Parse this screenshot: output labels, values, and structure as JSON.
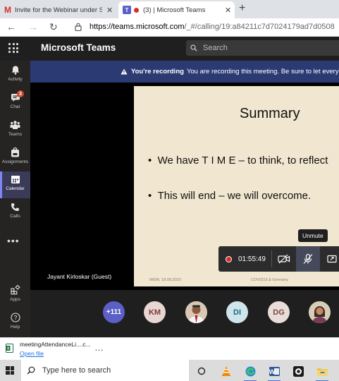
{
  "browser": {
    "tabs": [
      {
        "title": "Invite for the Webinar under Ser",
        "icon": "gmail-icon"
      },
      {
        "title": "(3) | Microsoft Teams",
        "icon": "teams-icon",
        "active": true
      }
    ],
    "address": {
      "host": "https://teams.microsoft.com",
      "path": "/_#/calling/19:a84211c7d7024179ad7d0508"
    }
  },
  "header": {
    "app_name": "Microsoft Teams",
    "search_placeholder": "Search"
  },
  "rail": {
    "items": [
      {
        "label": "Activity",
        "icon": "bell-icon"
      },
      {
        "label": "Chat",
        "icon": "chat-icon",
        "badge": "3"
      },
      {
        "label": "Teams",
        "icon": "teams-icon"
      },
      {
        "label": "Assignments",
        "icon": "backpack-icon"
      },
      {
        "label": "Calendar",
        "icon": "calendar-icon",
        "active": true
      },
      {
        "label": "Calls",
        "icon": "phone-icon"
      }
    ],
    "more": "•••",
    "bottom": [
      {
        "label": "Apps",
        "icon": "apps-icon"
      },
      {
        "label": "Help",
        "icon": "help-icon"
      }
    ]
  },
  "banner": {
    "strong": "You're recording",
    "text": "You are recording this meeting. Be sure to let every"
  },
  "stage": {
    "guest_name": "Jayant Kirloskar (Guest)",
    "slide": {
      "title": "Summary",
      "bullets": [
        "We have T I M E – to think, to reflect",
        "This will end – we will overcome."
      ],
      "footer_left": "IMDR, 18.08.2020",
      "footer_right": "COVID19 & Germany"
    }
  },
  "controls": {
    "timer": "01:55:49",
    "tooltip": "Unmute",
    "accent_red": "#d92c2c"
  },
  "participants": {
    "overflow": "+111",
    "avatars": [
      {
        "initials": "KM",
        "color": "#e8d6d3",
        "text_color": "#7a3d35"
      },
      {
        "initials": "",
        "color": "#c98f6f",
        "photo": true
      },
      {
        "initials": "DI",
        "color": "#cfe5ec",
        "text_color": "#1d6b86"
      },
      {
        "initials": "DG",
        "color": "#e9ddd9",
        "text_color": "#7a4b3c"
      },
      {
        "initials": "",
        "color": "#b5a58e",
        "photo": true
      }
    ]
  },
  "downloads": {
    "file_name": "meetingAttendanceLi....c...",
    "open_label": "Open file",
    "more": "…"
  },
  "taskbar": {
    "search_placeholder": "Type here to search"
  }
}
